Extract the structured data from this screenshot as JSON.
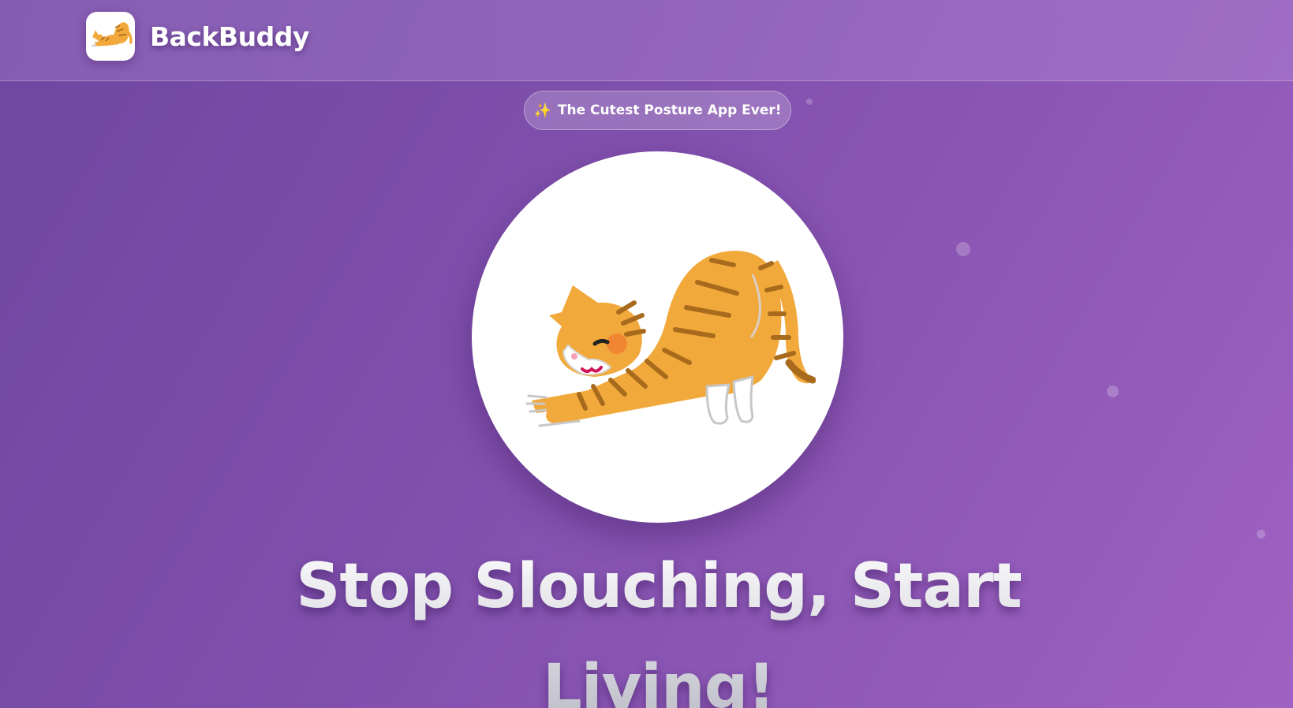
{
  "header": {
    "brand_name": "BackBuddy",
    "logo_icon": "stretching-cat-logo"
  },
  "hero": {
    "badge_icon": "sparkles",
    "badge_text": "The Cutest Posture App Ever!",
    "illustration": "stretching-cat",
    "headline": "Stop Slouching, Start Living!"
  },
  "colors": {
    "background_start": "#6f46a0",
    "background_end": "#9f62c2",
    "cat_orange": "#f2a93b",
    "cat_stripe": "#a86a1c",
    "sparkle": "#ffd34d"
  }
}
